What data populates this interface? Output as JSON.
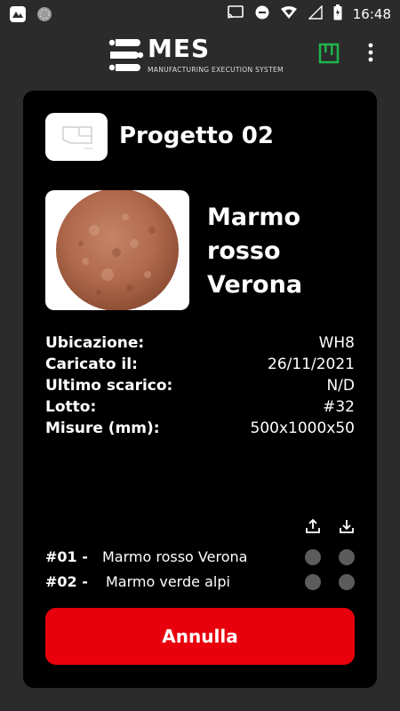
{
  "status_bar": {
    "time": "16:48",
    "left_icons": [
      "app-notification-icon",
      "sync-circle-icon"
    ],
    "right_icons": [
      "cast-icon",
      "do-not-disturb-icon",
      "wifi-icon",
      "signal-icon",
      "battery-icon"
    ]
  },
  "app_bar": {
    "logo_title": "MES",
    "logo_subtitle": "MANUFACTURING EXECUTION SYSTEM",
    "icons": [
      "mes-logo-icon",
      "box-status-icon",
      "more-vert-icon"
    ],
    "accent_color": "#1fb34d"
  },
  "project": {
    "title": "Progetto 02"
  },
  "material": {
    "name": "Marmo rosso Verona",
    "name_lines": [
      "Marmo",
      "rosso",
      "Verona"
    ]
  },
  "details": [
    {
      "label": "Ubicazione:",
      "value": "WH8"
    },
    {
      "label": "Caricato il:",
      "value": "26/11/2021"
    },
    {
      "label": "Ultimo scarico:",
      "value": "N/D"
    },
    {
      "label": "Lotto:",
      "value": "#32"
    },
    {
      "label": "Misure (mm):",
      "value": "500x1000x50"
    }
  ],
  "list_header_icons": [
    "upload-icon",
    "download-icon"
  ],
  "items": [
    {
      "num": "#01 -",
      "name": "Marmo rosso Verona"
    },
    {
      "num": "#02 -",
      "name": "Marmo verde alpi"
    }
  ],
  "cancel_label": "Annulla",
  "colors": {
    "background": "#2b2b2b",
    "card": "#000000",
    "button": "#e8000c",
    "dot": "#5c5c5c"
  }
}
